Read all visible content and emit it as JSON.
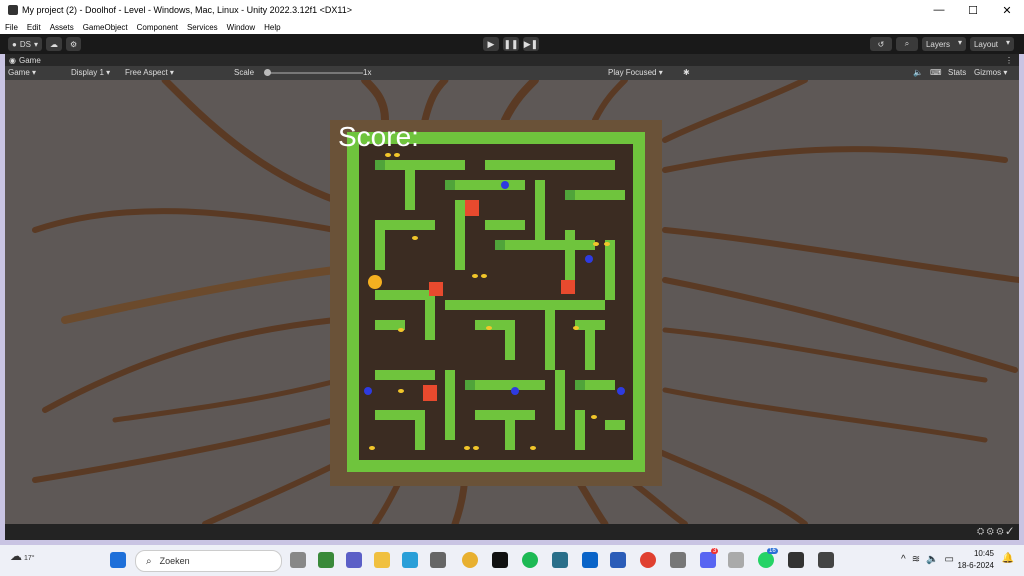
{
  "window": {
    "title": "My project (2) - Doolhof - Level - Windows, Mac, Linux - Unity 2022.3.12f1 <DX11>",
    "minimize_glyph": "—",
    "maximize_glyph": "☐",
    "close_glyph": "✕"
  },
  "menu": [
    "File",
    "Edit",
    "Assets",
    "GameObject",
    "Component",
    "Services",
    "Window",
    "Help"
  ],
  "toolbar": {
    "account": "DS",
    "play": "▶",
    "pause": "❚❚",
    "step": "▶❚",
    "layers": "Layers",
    "layout": "Layout"
  },
  "tab": {
    "label": "Game"
  },
  "game_toolbar": {
    "mode": "Game",
    "display": "Display 1",
    "aspect": "Free Aspect",
    "scale_label": "Scale",
    "scale_value": "1x",
    "play_mode": "Play Focused",
    "stats": "Stats",
    "gizmos": "Gizmos"
  },
  "game": {
    "score_text": "Score:",
    "colors": {
      "maze": "#6fc43d",
      "wall_top": "#4fa43a",
      "floor": "#3b2c22",
      "board": "#6a5238",
      "background": "#5a5553",
      "block": "#e84a2e",
      "coin": "#f2c62a",
      "ghost": "#2e3be0",
      "roots": "#5a3a24"
    }
  },
  "taskbar": {
    "weather_temp": "17°",
    "search_placeholder": "Zoeken",
    "time": "10:45",
    "date": "18-6-2024",
    "discord_badge": "3",
    "whatsapp_badge": "16"
  }
}
